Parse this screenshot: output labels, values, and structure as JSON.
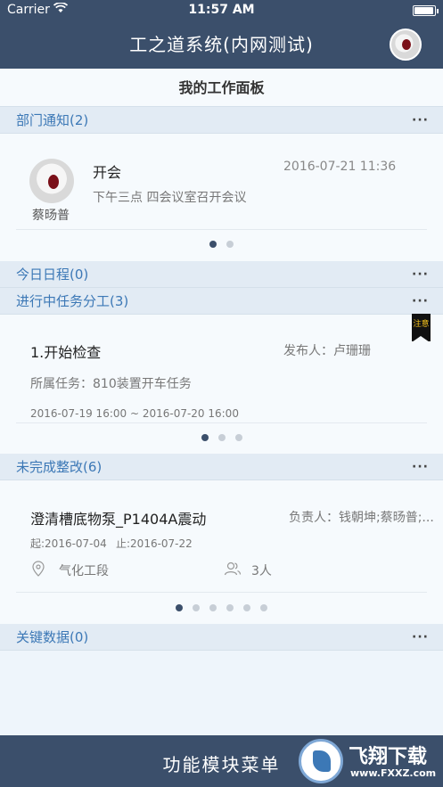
{
  "status": {
    "carrier": "Carrier",
    "time": "11:57 AM"
  },
  "nav": {
    "title": "工之道系统(内网测试)"
  },
  "board": {
    "title": "我的工作面板"
  },
  "sections": {
    "notice": {
      "title": "部门通知(2)",
      "more": "···"
    },
    "schedule": {
      "title": "今日日程(0)",
      "more": "···"
    },
    "tasks": {
      "title": "进行中任务分工(3)",
      "more": "···"
    },
    "rectify": {
      "title": "未完成整改(6)",
      "more": "···"
    },
    "keydata": {
      "title": "关键数据(0)",
      "more": "···"
    }
  },
  "notice": {
    "author": "蔡旸普",
    "title": "开会",
    "datetime": "2016-07-21 11:36",
    "content": "下午三点 四会议室召开会议",
    "pages": 2,
    "active": 0
  },
  "task": {
    "title": "1.开始检查",
    "publisher": "发布人：卢珊珊",
    "belongs": "所属任务：810装置开车任务",
    "period": "2016-07-19 16:00 ~ 2016-07-20 16:00",
    "badge": "注意",
    "pages": 3,
    "active": 0
  },
  "rectify": {
    "title": "澄清槽底物泵_P1404A震动",
    "owner": "负责人：钱朝坤;蔡旸普;...",
    "start": "起:2016-07-04",
    "end": "止:2016-07-22",
    "location": "气化工段",
    "people": "3人",
    "pages": 6,
    "active": 0
  },
  "bottom": {
    "label": "功能模块菜单"
  },
  "watermark": {
    "text": "飞翔下载",
    "url": "www.FXXZ.com"
  },
  "colors": {
    "nav": "#3b4f6b",
    "accent": "#3c78b6",
    "badge": "#f5c21b"
  }
}
